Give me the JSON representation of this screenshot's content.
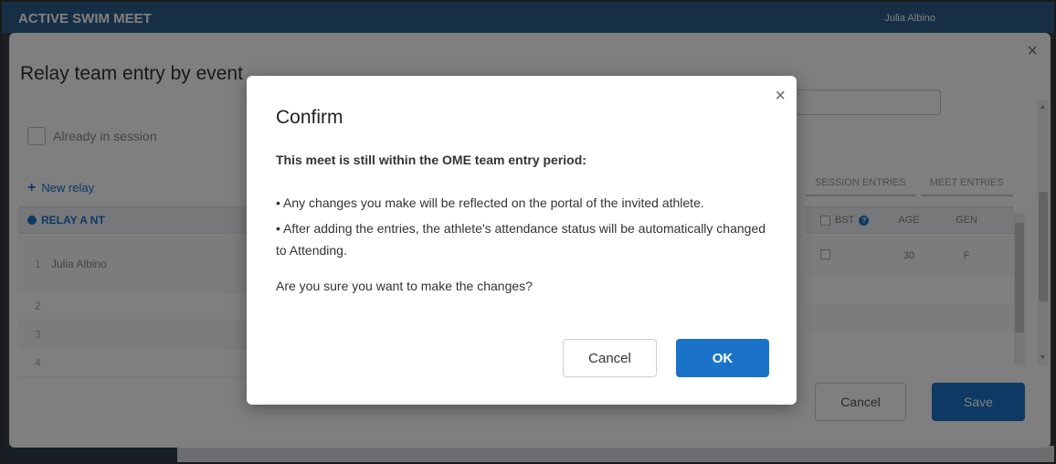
{
  "app": {
    "brand": "ACTIVE SWIM MEET",
    "user": "Julia Albino"
  },
  "background_modal": {
    "title": "Relay team entry by event",
    "already_in_session_label": "Already in session",
    "new_relay_label": "New relay",
    "relay_header": "RELAY A  NT",
    "relay_rows": [
      {
        "num": "1",
        "name": "Julia Albino"
      },
      {
        "num": "2",
        "name": ""
      },
      {
        "num": "3",
        "name": ""
      },
      {
        "num": "4",
        "name": ""
      }
    ],
    "tabs": [
      "SESSION ENTRIES",
      "MEET ENTRIES"
    ],
    "columns": {
      "bst": "BST",
      "age": "AGE",
      "gender": "GEN"
    },
    "athlete_rows": [
      {
        "age": "30",
        "gender": "F"
      },
      {
        "age": "",
        "gender": ""
      },
      {
        "age": "",
        "gender": ""
      },
      {
        "age": "",
        "gender": ""
      }
    ],
    "cancel_label": "Cancel",
    "save_label": "Save"
  },
  "dialog": {
    "title": "Confirm",
    "heading": "This meet is still within the OME team entry period:",
    "bullets": [
      "• Any changes you make will be reflected on the portal of the invited athlete.",
      "• After adding the entries, the athlete's attendance status will be automatically changed to Attending."
    ],
    "question": "Are you sure you want to make the changes?",
    "cancel_label": "Cancel",
    "ok_label": "OK"
  },
  "icons": {
    "close": "×",
    "plus": "+",
    "help": "?"
  },
  "colors": {
    "primary": "#1a73c9",
    "overlay": "rgba(0,0,0,0.5)"
  }
}
